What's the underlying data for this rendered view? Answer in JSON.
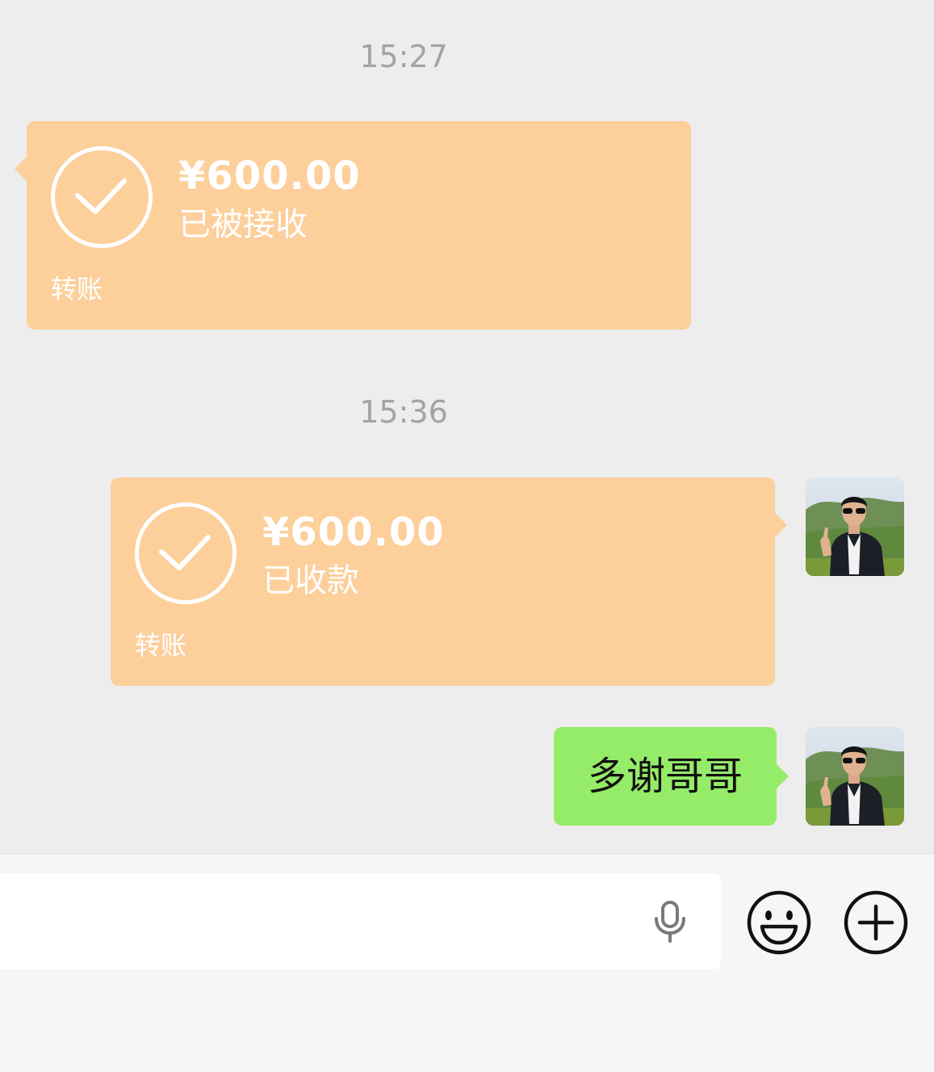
{
  "chat": {
    "timestamps": [
      "15:27",
      "15:36"
    ],
    "transfers": [
      {
        "amount": "¥600.00",
        "status": "已被接收",
        "label": "转账"
      },
      {
        "amount": "¥600.00",
        "status": "已收款",
        "label": "转账"
      }
    ],
    "text_message": "多谢哥哥"
  },
  "input_bar": {
    "icons": [
      "microphone-icon",
      "emoji-icon",
      "plus-icon"
    ]
  },
  "colors": {
    "background": "#ededed",
    "transfer_bubble": "#fccf9b",
    "text_bubble": "#95ec69",
    "input_bar": "#f6f6f6"
  }
}
